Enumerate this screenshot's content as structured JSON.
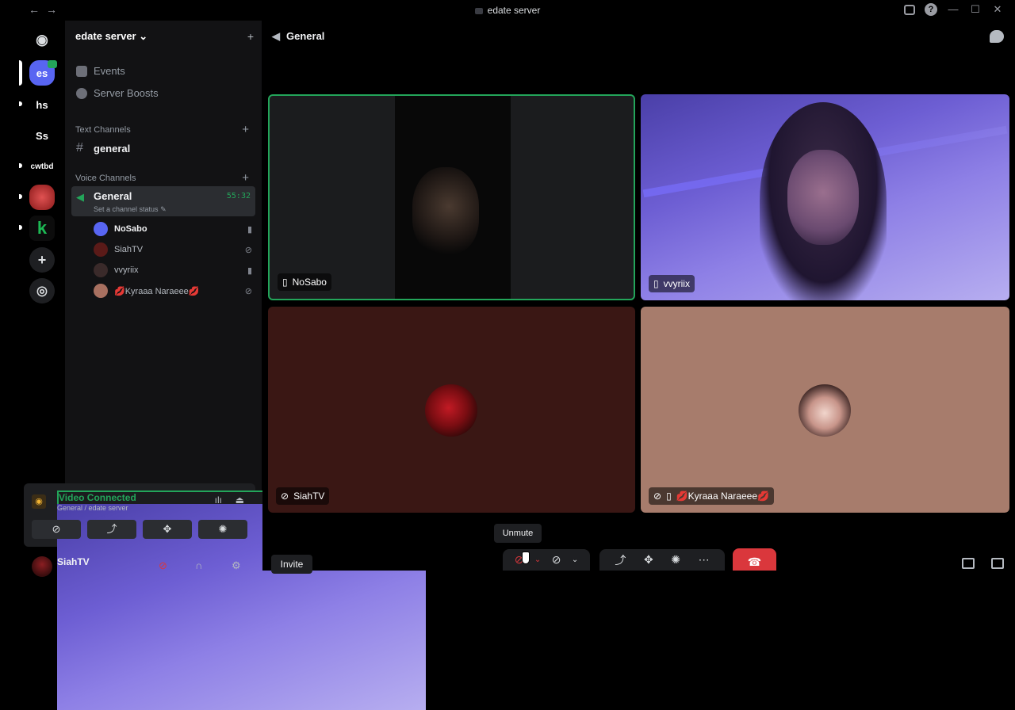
{
  "window": {
    "title": "edate server",
    "back_glyph": "←",
    "forward_glyph": "→",
    "icons": [
      "inbox-icon",
      "help-icon",
      "minimize-icon",
      "maximize-icon",
      "close-icon"
    ],
    "help_glyph": "?",
    "min_glyph": "—",
    "max_glyph": "☐",
    "close_glyph": "✕"
  },
  "rail": {
    "home_glyph": "◉",
    "servers": [
      {
        "label": "es",
        "color": "#5865f2",
        "active": true,
        "notification": true
      },
      {
        "label": "hs",
        "color": "#000000",
        "active": false
      },
      {
        "label": "Ss",
        "color": "#000000",
        "active": false
      },
      {
        "label": "cwtbd",
        "color": "#000000",
        "active": false
      },
      {
        "label": "",
        "color": "#c42b2b",
        "active": false
      },
      {
        "label": "",
        "color": "#1db954",
        "active": false
      }
    ],
    "add_glyph": "+",
    "discover_glyph": "◎"
  },
  "sidebar": {
    "server_name": "edate server",
    "server_chevron": "⌄",
    "invite_glyph": "+",
    "events_label": "Events",
    "boosts_label": "Server Boosts",
    "text_category": "Text Channels",
    "text_channels": [
      {
        "name": "general"
      }
    ],
    "voice_category": "Voice Channels",
    "add_glyph": "+",
    "voice_channel": {
      "name": "General",
      "timer": "55:32",
      "status": "Set a channel status",
      "edit_glyph": "✎"
    },
    "voice_users": [
      {
        "name": "NoSabo",
        "avatar_color": "#5865f2",
        "status_glyph": "▮",
        "bold": true
      },
      {
        "name": "SiahTV",
        "avatar_color": "#5a1a18",
        "status_glyph": "⊘",
        "bold": false
      },
      {
        "name": "vvyriix",
        "avatar_color": "#3a2a2a",
        "status_glyph": "▮",
        "bold": false
      },
      {
        "name": "💋Kyraaa Naraeee💋",
        "avatar_color": "#a87060",
        "status_glyph": "⊘",
        "bold": false
      }
    ],
    "voice_panel": {
      "status": "Video Connected",
      "location": "General / edate server",
      "signal_glyph": "ılı",
      "disconnect_glyph": "⏏",
      "buttons": [
        {
          "name": "camera-off-button",
          "glyph": "⊘"
        },
        {
          "name": "screenshare-button",
          "glyph": "⤴"
        },
        {
          "name": "activities-button",
          "glyph": "✥"
        },
        {
          "name": "soundboard-button",
          "glyph": "✺"
        }
      ]
    },
    "user_panel": {
      "username": "SiahTV",
      "mic_glyph": "⊘",
      "headset_glyph": "∩",
      "settings_glyph": "⚙"
    }
  },
  "main": {
    "channel_title": "General",
    "speaker_glyph": "◀",
    "tiles": [
      {
        "name": "NoSabo",
        "icon": "📱",
        "speaking": true
      },
      {
        "name": "vvyriix",
        "icon": "📱",
        "speaking": false
      },
      {
        "name": "SiahTV",
        "icon": "⊘",
        "speaking": false
      },
      {
        "name": "💋Kyraaa Naraeee💋",
        "icon": "⊘ 📱",
        "speaking": false
      }
    ],
    "invite_label": "Invite",
    "tooltip": "Unmute",
    "controls": {
      "mic_glyph": "⊘",
      "chevron_glyph": "⌄",
      "camera_glyph": "⊘",
      "share_glyph": "⤴",
      "activity_glyph": "✥",
      "soundboard_glyph": "✺",
      "more_glyph": "⋯",
      "hangup_glyph": "☎"
    }
  },
  "colors": {
    "accent": "#5865f2",
    "connected_green": "#23a55a",
    "danger_red": "#da373c"
  }
}
